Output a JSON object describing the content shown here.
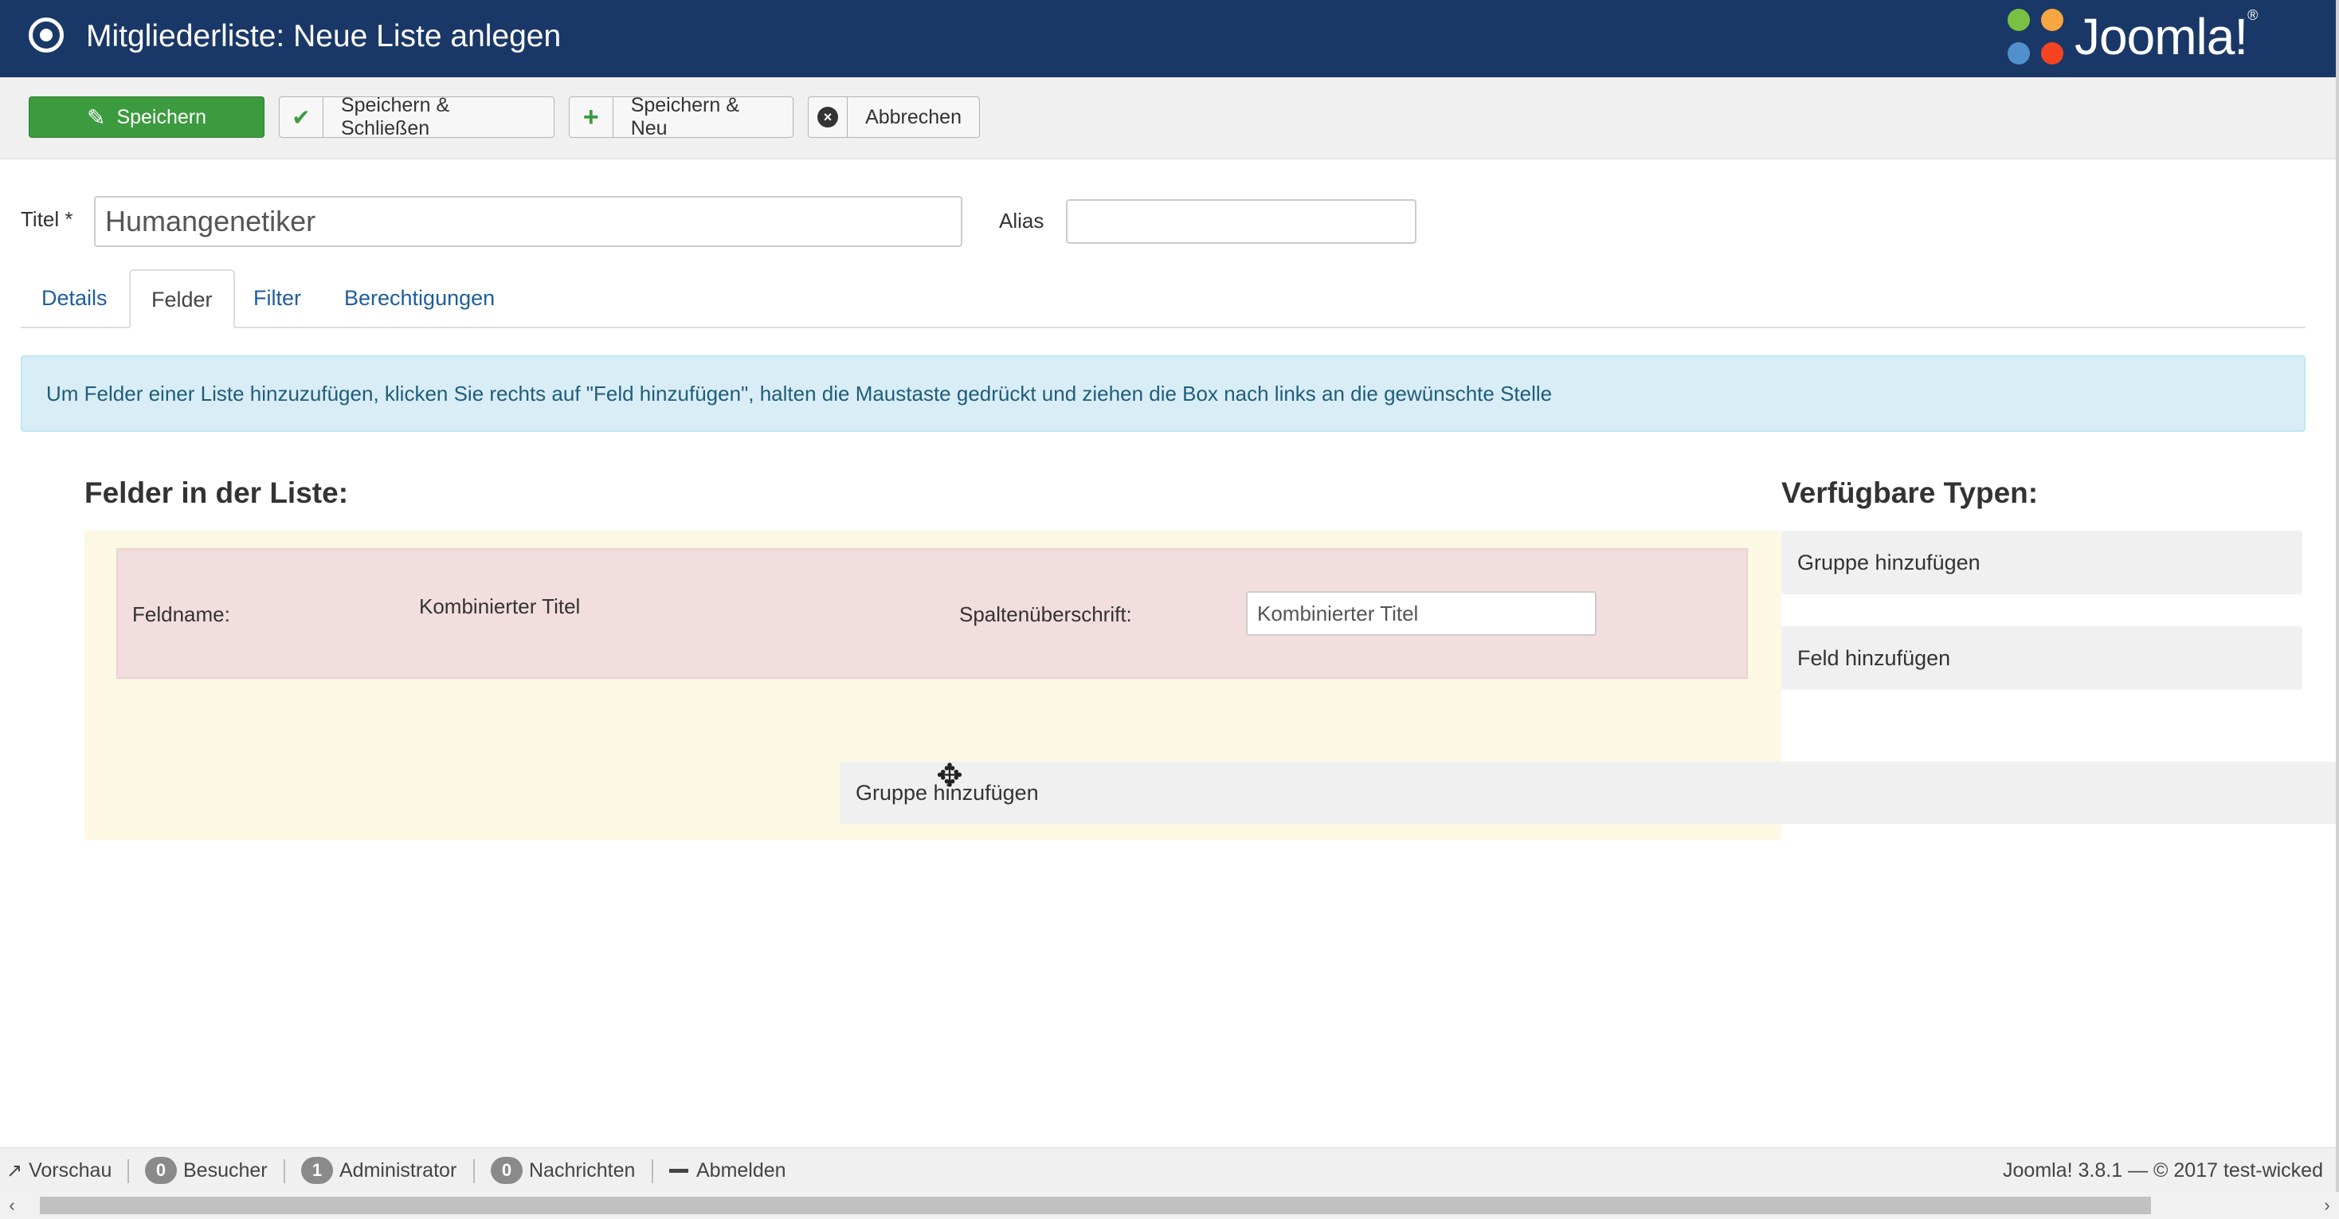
{
  "header": {
    "title": "Mitgliederliste: Neue Liste anlegen",
    "logo_text": "Joomla!",
    "logo_registered": "®",
    "colors": {
      "background": "#1a3867"
    }
  },
  "toolbar": {
    "save_label": "Speichern",
    "save_close_label": "Speichern & Schließen",
    "save_new_label": "Speichern & Neu",
    "cancel_label": "Abbrechen",
    "icons": {
      "save": "edit-icon",
      "save_close": "check-icon",
      "save_new": "plus-icon",
      "cancel": "close-circle-icon"
    },
    "colors": {
      "save_bg": "#3c9b3f"
    }
  },
  "form": {
    "title_label": "Titel *",
    "title_value": "Humangenetiker",
    "alias_label": "Alias",
    "alias_value": ""
  },
  "tabs": [
    {
      "label": "Details",
      "active": false
    },
    {
      "label": "Felder",
      "active": true
    },
    {
      "label": "Filter",
      "active": false
    },
    {
      "label": "Berechtigungen",
      "active": false
    }
  ],
  "info_message": "Um Felder einer Liste hinzuzufügen, klicken Sie rechts auf \"Feld hinzufügen\", halten die Maustaste gedrückt und ziehen die Box nach links an die gewünschte Stelle",
  "fields_list": {
    "heading": "Felder in der Liste:",
    "field": {
      "name_label": "Feldname:",
      "name_value": "Kombinierter Titel",
      "column_label": "Spaltenüberschrift:",
      "column_value": "Kombinierter Titel"
    }
  },
  "available_types": {
    "heading": "Verfügbare Typen:",
    "items": [
      "Gruppe hinzufügen",
      "Feld hinzufügen"
    ]
  },
  "dragging": {
    "label": "Gruppe hinzufügen"
  },
  "statusbar": {
    "preview_label": "Vorschau",
    "visitors_count": "0",
    "visitors_label": "Besucher",
    "admin_count": "1",
    "admin_label": "Administrator",
    "messages_count": "0",
    "messages_label": "Nachrichten",
    "logout_label": "Abmelden",
    "version": "Joomla! 3.8.1",
    "copyright": "— © 2017 test-wicked"
  }
}
